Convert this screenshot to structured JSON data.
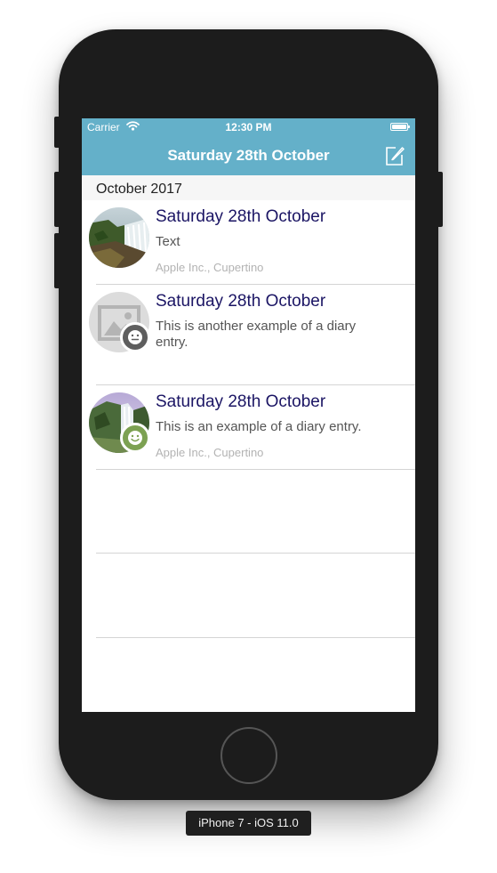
{
  "status_bar": {
    "carrier": "Carrier",
    "time": "12:30 PM"
  },
  "nav": {
    "title": "Saturday 28th October",
    "compose_icon": "compose-icon"
  },
  "section": {
    "title": "October 2017"
  },
  "entries": [
    {
      "title": "Saturday 28th October",
      "text": "Text",
      "location": "Apple Inc., Cupertino",
      "image": "waterfall-photo",
      "mood": ""
    },
    {
      "title": "Saturday 28th October",
      "text": "This is another example of a diary entry.",
      "location": "",
      "image": "image-placeholder",
      "mood": "neutral"
    },
    {
      "title": "Saturday 28th October",
      "text": "This is an example of a diary entry.",
      "location": "Apple Inc., Cupertino",
      "image": "waterfall-photo",
      "mood": "happy"
    }
  ],
  "device_label": "iPhone 7 - iOS 11.0",
  "colors": {
    "nav_bar": "#64b0c9",
    "entry_title": "#1b1564",
    "neutral_badge": "#5e5e5e",
    "happy_badge": "#7ca152",
    "section_header_bg": "#f6f6f6"
  }
}
